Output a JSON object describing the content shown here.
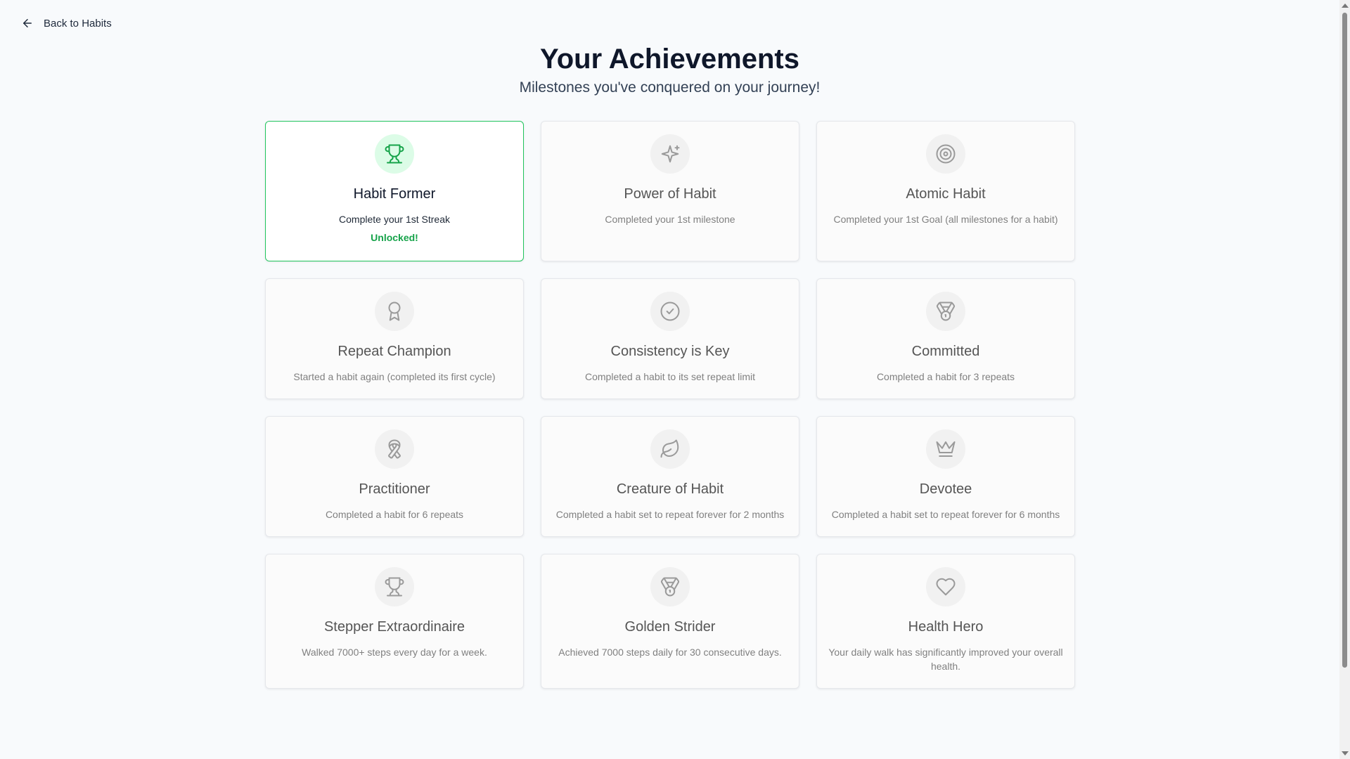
{
  "back_link": {
    "label": "Back to Habits"
  },
  "header": {
    "title": "Your Achievements",
    "subtitle": "Milestones you've conquered on your journey!"
  },
  "colors": {
    "accent": "#16a34a",
    "unlocked_border": "#22c55e",
    "unlocked_icon_bg": "#dcfce7"
  },
  "achievements": [
    {
      "icon": "trophy-icon",
      "title": "Habit Former",
      "desc": "Complete your 1st Streak",
      "status": "Unlocked!",
      "unlocked": true
    },
    {
      "icon": "sparkle-icon",
      "title": "Power of Habit",
      "desc": "Completed your 1st milestone",
      "status": "",
      "unlocked": false
    },
    {
      "icon": "target-icon",
      "title": "Atomic Habit",
      "desc": "Completed your 1st Goal (all milestones for a habit)",
      "status": "",
      "unlocked": false
    },
    {
      "icon": "award-icon",
      "title": "Repeat Champion",
      "desc": "Started a habit again (completed its first cycle)",
      "status": "",
      "unlocked": false
    },
    {
      "icon": "check-circle-icon",
      "title": "Consistency is Key",
      "desc": "Completed a habit to its set repeat limit",
      "status": "",
      "unlocked": false
    },
    {
      "icon": "medal-icon",
      "title": "Committed",
      "desc": "Completed a habit for 3 repeats",
      "status": "",
      "unlocked": false
    },
    {
      "icon": "ribbon-icon",
      "title": "Practitioner",
      "desc": "Completed a habit for 6 repeats",
      "status": "",
      "unlocked": false
    },
    {
      "icon": "leaf-icon",
      "title": "Creature of Habit",
      "desc": "Completed a habit set to repeat forever for 2 months",
      "status": "",
      "unlocked": false
    },
    {
      "icon": "crown-icon",
      "title": "Devotee",
      "desc": "Completed a habit set to repeat forever for 6 months",
      "status": "",
      "unlocked": false
    },
    {
      "icon": "trophy-icon",
      "title": "Stepper Extraordinaire",
      "desc": "Walked 7000+ steps every day for a week.",
      "status": "",
      "unlocked": false
    },
    {
      "icon": "medal-icon",
      "title": "Golden Strider",
      "desc": "Achieved 7000 steps daily for 30 consecutive days.",
      "status": "",
      "unlocked": false
    },
    {
      "icon": "heart-icon",
      "title": "Health Hero",
      "desc": "Your daily walk has significantly improved your overall health.",
      "status": "",
      "unlocked": false
    }
  ]
}
